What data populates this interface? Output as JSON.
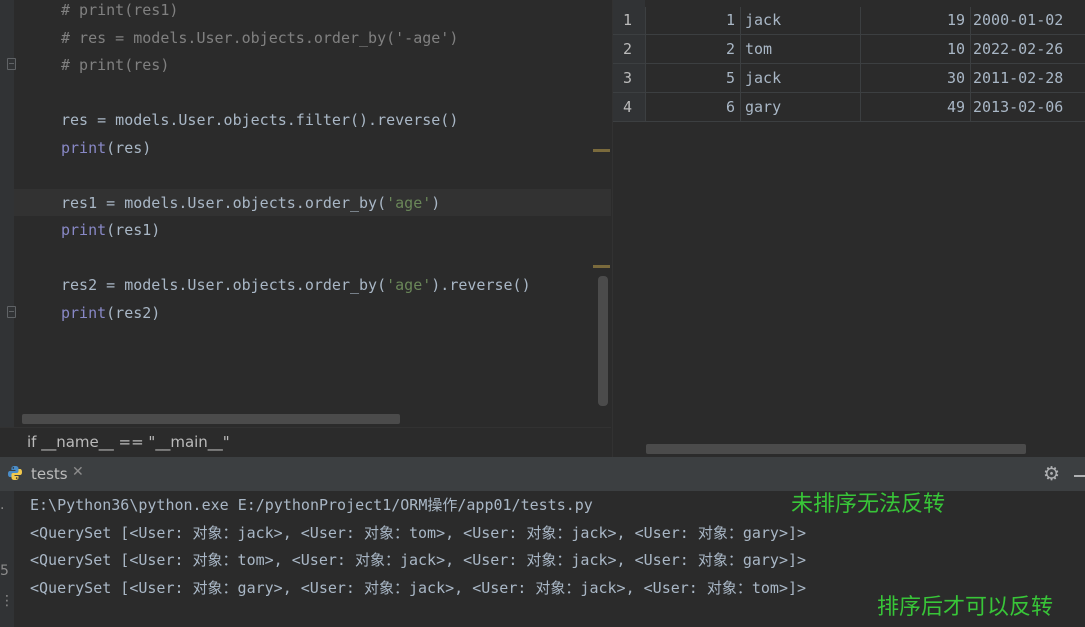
{
  "editor": {
    "lines": [
      {
        "parts": [
          {
            "t": "# print(res1)",
            "c": "comment"
          }
        ]
      },
      {
        "parts": [
          {
            "t": "# res = models.User.objects.order_by('-age')",
            "c": "comment"
          }
        ]
      },
      {
        "parts": [
          {
            "t": "# print(res)",
            "c": "comment"
          }
        ]
      },
      {
        "parts": [
          {
            "t": "res = models.User.objects.filter().reverse()",
            "c": ""
          }
        ]
      },
      {
        "parts": [
          {
            "t": "print",
            "c": "builtin"
          },
          {
            "t": "(res)",
            "c": ""
          }
        ]
      },
      {
        "parts": [
          {
            "t": "res1 = models.User.objects.order_by(",
            "c": ""
          },
          {
            "t": "'age'",
            "c": "str"
          },
          {
            "t": ")",
            "c": ""
          }
        ]
      },
      {
        "parts": [
          {
            "t": "print",
            "c": "builtin"
          },
          {
            "t": "(res1)",
            "c": ""
          }
        ]
      },
      {
        "parts": [
          {
            "t": "res2 = models.User.objects.order_by(",
            "c": ""
          },
          {
            "t": "'age'",
            "c": "str"
          },
          {
            "t": ").reverse()",
            "c": ""
          }
        ]
      },
      {
        "parts": [
          {
            "t": "print",
            "c": "builtin"
          },
          {
            "t": "(res2)",
            "c": ""
          }
        ]
      }
    ],
    "breadcrumb": "if __name__ == \"__main__\""
  },
  "db_grid": {
    "rows": [
      {
        "row": "1",
        "id": "1",
        "name": "jack",
        "age": "19",
        "date": "2000-01-02"
      },
      {
        "row": "2",
        "id": "2",
        "name": "tom",
        "age": "10",
        "date": "2022-02-26"
      },
      {
        "row": "3",
        "id": "5",
        "name": "jack",
        "age": "30",
        "date": "2011-02-28"
      },
      {
        "row": "4",
        "id": "6",
        "name": "gary",
        "age": "49",
        "date": "2013-02-06"
      }
    ]
  },
  "run_panel": {
    "tab_label": "tests",
    "tab_icon": "python-icon",
    "close_glyph": "✕",
    "settings_icon": "gear-icon"
  },
  "console": {
    "command": "E:\\Python36\\python.exe E:/pythonProject1/ORM操作/app01/tests.py",
    "outputs": [
      "<QuerySet [<User: 对象：jack>, <User: 对象：tom>, <User: 对象：jack>, <User: 对象：gary>]>",
      "<QuerySet [<User: 对象：tom>, <User: 对象：jack>, <User: 对象：jack>, <User: 对象：gary>]>",
      "<QuerySet [<User: 对象：gary>, <User: 对象：jack>, <User: 对象：jack>, <User: 对象：tom>]>"
    ],
    "gutter_mark": "5",
    "annotation_unsorted": "未排序无法反转",
    "annotation_sorted": "排序后才可以反转",
    "annotation_color": "#38c538"
  }
}
